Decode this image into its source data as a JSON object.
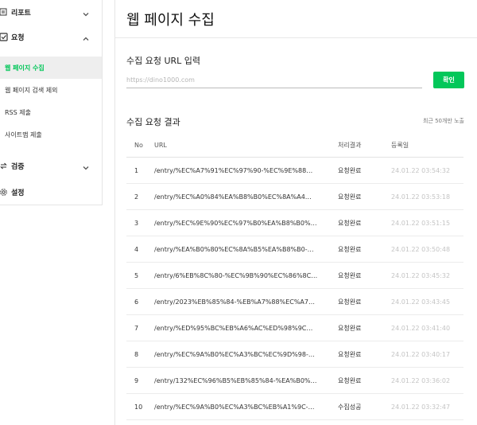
{
  "sidebar": {
    "groups": [
      {
        "label": "리포트",
        "icon": "report-icon",
        "expanded": false
      },
      {
        "label": "요청",
        "icon": "check-square-icon",
        "expanded": true
      },
      {
        "label": "검증",
        "icon": "swap-arrows-icon",
        "expanded": false
      },
      {
        "label": "설정",
        "icon": "gear-icon"
      }
    ],
    "request_items": [
      {
        "label": "웹 페이지 수집",
        "active": true
      },
      {
        "label": "웹 페이지 검색 제외"
      },
      {
        "label": "RSS 제출"
      },
      {
        "label": "사이트맵 제출"
      }
    ]
  },
  "main": {
    "title": "웹 페이지 수집",
    "url_section": {
      "heading": "수집 요청 URL 입력",
      "placeholder": "https://dino1000.com",
      "value": "",
      "confirm_label": "확인"
    },
    "results": {
      "heading": "수집 요청 결과",
      "note": "최근 50개만 노출",
      "columns": [
        "No",
        "URL",
        "처리결과",
        "등록일"
      ],
      "rows": [
        {
          "no": "1",
          "url": "/entry/%EC%A7%91%EC%97%90-%EC%9E%88…",
          "status": "요청완료",
          "date": "24.01.22 03:54:32"
        },
        {
          "no": "2",
          "url": "/entry/%EC%A0%84%EA%B8%B0%EC%8A%A4…",
          "status": "요청완료",
          "date": "24.01.22 03:53:18"
        },
        {
          "no": "3",
          "url": "/entry/%EC%9E%90%EC%97%B0%EA%B8%B0%…",
          "status": "요청완료",
          "date": "24.01.22 03:51:15"
        },
        {
          "no": "4",
          "url": "/entry/%EA%B0%80%EC%8A%B5%EA%B8%B0-…",
          "status": "요청완료",
          "date": "24.01.22 03:50:48"
        },
        {
          "no": "5",
          "url": "/entry/6%EB%8C%80-%EC%9B%90%EC%86%8C…",
          "status": "요청완료",
          "date": "24.01.22 03:45:32"
        },
        {
          "no": "6",
          "url": "/entry/2023%EB%85%84-%EB%A7%88%EC%A7…",
          "status": "요청완료",
          "date": "24.01.22 03:43:45"
        },
        {
          "no": "7",
          "url": "/entry/%ED%95%BC%EB%A6%AC%ED%98%9C…",
          "status": "요청완료",
          "date": "24.01.22 03:41:40"
        },
        {
          "no": "8",
          "url": "/entry/%EC%9A%B0%EC%A3%BC%EC%9D%98-…",
          "status": "요청완료",
          "date": "24.01.22 03:40:17"
        },
        {
          "no": "9",
          "url": "/entry/132%EC%96%B5%EB%85%84-%EA%B0%…",
          "status": "요청완료",
          "date": "24.01.22 03:36:02"
        },
        {
          "no": "10",
          "url": "/entry/%EC%9A%B0%EC%A3%BC%EB%A1%9C-…",
          "status": "수집성공",
          "date": "24.01.22 03:32:47"
        }
      ]
    }
  },
  "colors": {
    "accent": "#03c75a",
    "date_text": "#c4c4c4",
    "active_bg": "#eeeeee"
  }
}
